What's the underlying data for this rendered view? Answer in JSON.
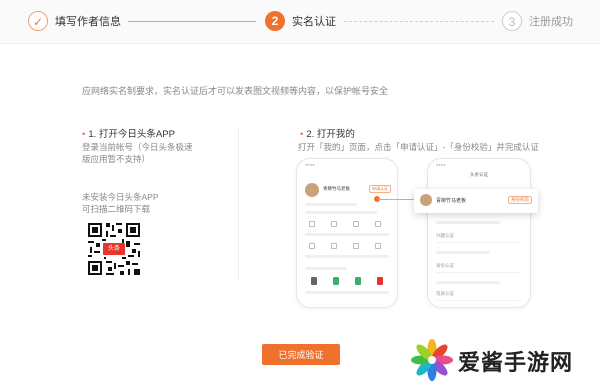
{
  "steps": [
    {
      "label": "填写作者信息",
      "state": "done",
      "icon": "check-icon"
    },
    {
      "label": "实名认证",
      "state": "active",
      "number": "2"
    },
    {
      "label": "注册成功",
      "state": "todo",
      "number": "3"
    }
  ],
  "notice": "应网络实名制要求，实名认证后才可以发表图文视频等内容，以保护帐号安全",
  "left": {
    "title": "1. 打开今日头条APP",
    "desc1": "登录当前帐号（今日头条极速版应用暂不支持）",
    "desc2_line1": "未安装今日头条APP",
    "desc2_line2": "可扫描二维码下载",
    "qr_badge": "头条"
  },
  "right": {
    "title": "2. 打开我的",
    "desc": "打开「我的」页面，点击「申请认证」-「身份校验」并完成认证",
    "phone_a_name": "青柳竹马老板",
    "phone_a_tag": "申请认证",
    "phone_b_header": "头条认证",
    "callout_name": "青柳竹马老板",
    "callout_tag": "身份校验",
    "phone_b_items": [
      "兴趣认证",
      "身份认证",
      "资质认证"
    ]
  },
  "button_label": "已完成验证",
  "watermark": "爱酱手游网",
  "colors": {
    "accent": "#f0712e",
    "accent_light": "#f0a070",
    "muted": "#cfcfcf"
  }
}
